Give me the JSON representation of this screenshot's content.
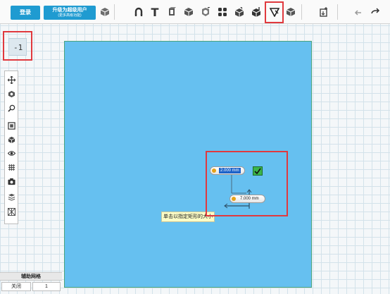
{
  "toolbar": {
    "button_small_label": "登录",
    "button_big_line1": "升级为超级用户",
    "button_big_line2": "(更多高级功能)",
    "icons": [
      "cube-icon",
      "magnet-icon",
      "text-tool-icon",
      "extrude-icon",
      "push-pull-icon",
      "revolve-icon",
      "chamfer-icon",
      "array-icon",
      "shell-icon",
      "fillet-icon",
      "sketch-dimension-icon",
      "measure-icon",
      "import-icon",
      "undo-icon",
      "redo-icon"
    ],
    "text_tool_glyph": "T"
  },
  "side": {
    "grid_toggle_label": "-1",
    "tools": [
      "move-icon",
      "rotate-view-icon",
      "zoom-icon",
      "fit-view-icon",
      "view-cube-icon",
      "visibility-icon",
      "grid-view-icon",
      "camera-icon",
      "layers-icon",
      "materials-icon"
    ]
  },
  "canvas": {
    "dim_horizontal": "2.000 mm",
    "dim_vertical": "7.000 mm",
    "tooltip": "单击以指定矩形的大小"
  },
  "status": {
    "title": "辅助网格",
    "cell_left": "关闭",
    "cell_right": "1"
  },
  "colors": {
    "accent": "#1f9bd1",
    "canvas_fill": "#66c0f0",
    "highlight": "#e0393e",
    "confirm": "#3bb54a"
  }
}
